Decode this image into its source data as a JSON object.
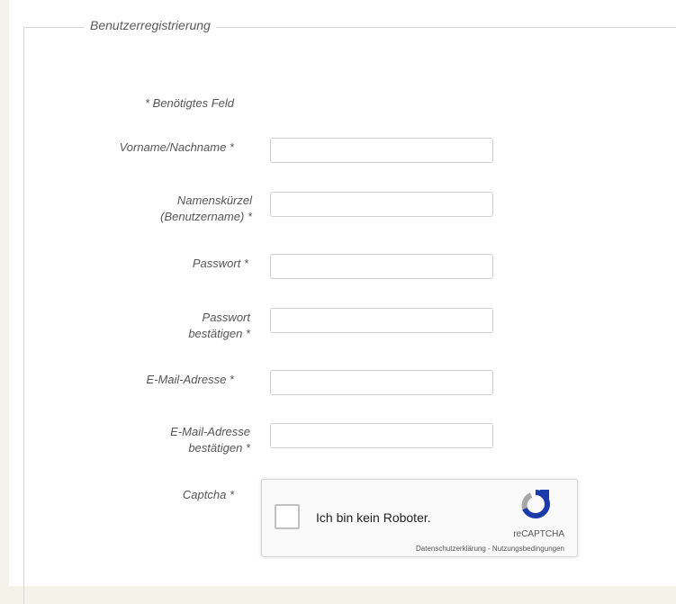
{
  "form": {
    "legend": "Benutzerregistrierung",
    "required_note": "* Benötigtes Feld",
    "fields": {
      "name_label": "Vorname/Nachname *",
      "username_label_line1": "Namenskürzel",
      "username_label_line2": "(Benutzername) *",
      "password_label": "Passwort *",
      "password_confirm_label_line1": "Passwort",
      "password_confirm_label_line2": "bestätigen *",
      "email_label": "E-Mail-Adresse *",
      "email_confirm_label_line1": "E-Mail-Adresse",
      "email_confirm_label_line2": "bestätigen *",
      "captcha_label": "Captcha *"
    },
    "captcha": {
      "checkbox_text": "Ich bin kein Roboter.",
      "brand": "reCAPTCHA",
      "links": "Datenschutzerklärung - Nutzungsbedingungen",
      "icon": "recaptcha-logo"
    }
  },
  "colors": {
    "page_bg": "#f3f3ea",
    "panel_bg": "#ffffff",
    "border": "#d7d7d7",
    "captcha_blue": "#1c3aa9",
    "captcha_grey": "#a6a6a6"
  }
}
